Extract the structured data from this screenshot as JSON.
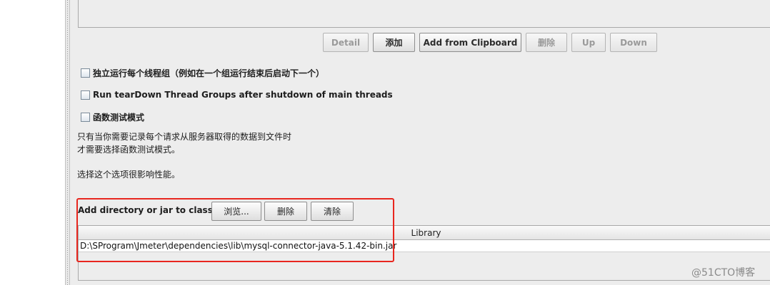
{
  "toolbar": {
    "detail": "Detail",
    "add": "添加",
    "add_from_clipboard": "Add from Clipboard",
    "delete": "删除",
    "up": "Up",
    "down": "Down"
  },
  "options": {
    "run_groups_consecutively": "独立运行每个线程组（例如在一个组运行结束后启动下一个）",
    "run_teardown": "Run tearDown Thread Groups after shutdown of main threads",
    "functional_test_mode": "函数测试模式"
  },
  "notes": {
    "line1": "只有当你需要记录每个请求从服务器取得的数据到文件时",
    "line2": "才需要选择函数测试模式。",
    "line3": "选择这个选项很影响性能。"
  },
  "classpath": {
    "label": "Add directory or jar to classpath",
    "browse": "浏览...",
    "delete": "删除",
    "clear": "清除",
    "column_header": "Library",
    "rows": [
      "D:\\SProgram\\Jmeter\\dependencies\\lib\\mysql-connector-java-5.1.42-bin.jar"
    ]
  },
  "watermark": "@51CTO博客",
  "colors": {
    "highlight": "#e8261e",
    "panel_bg": "#ededed"
  }
}
